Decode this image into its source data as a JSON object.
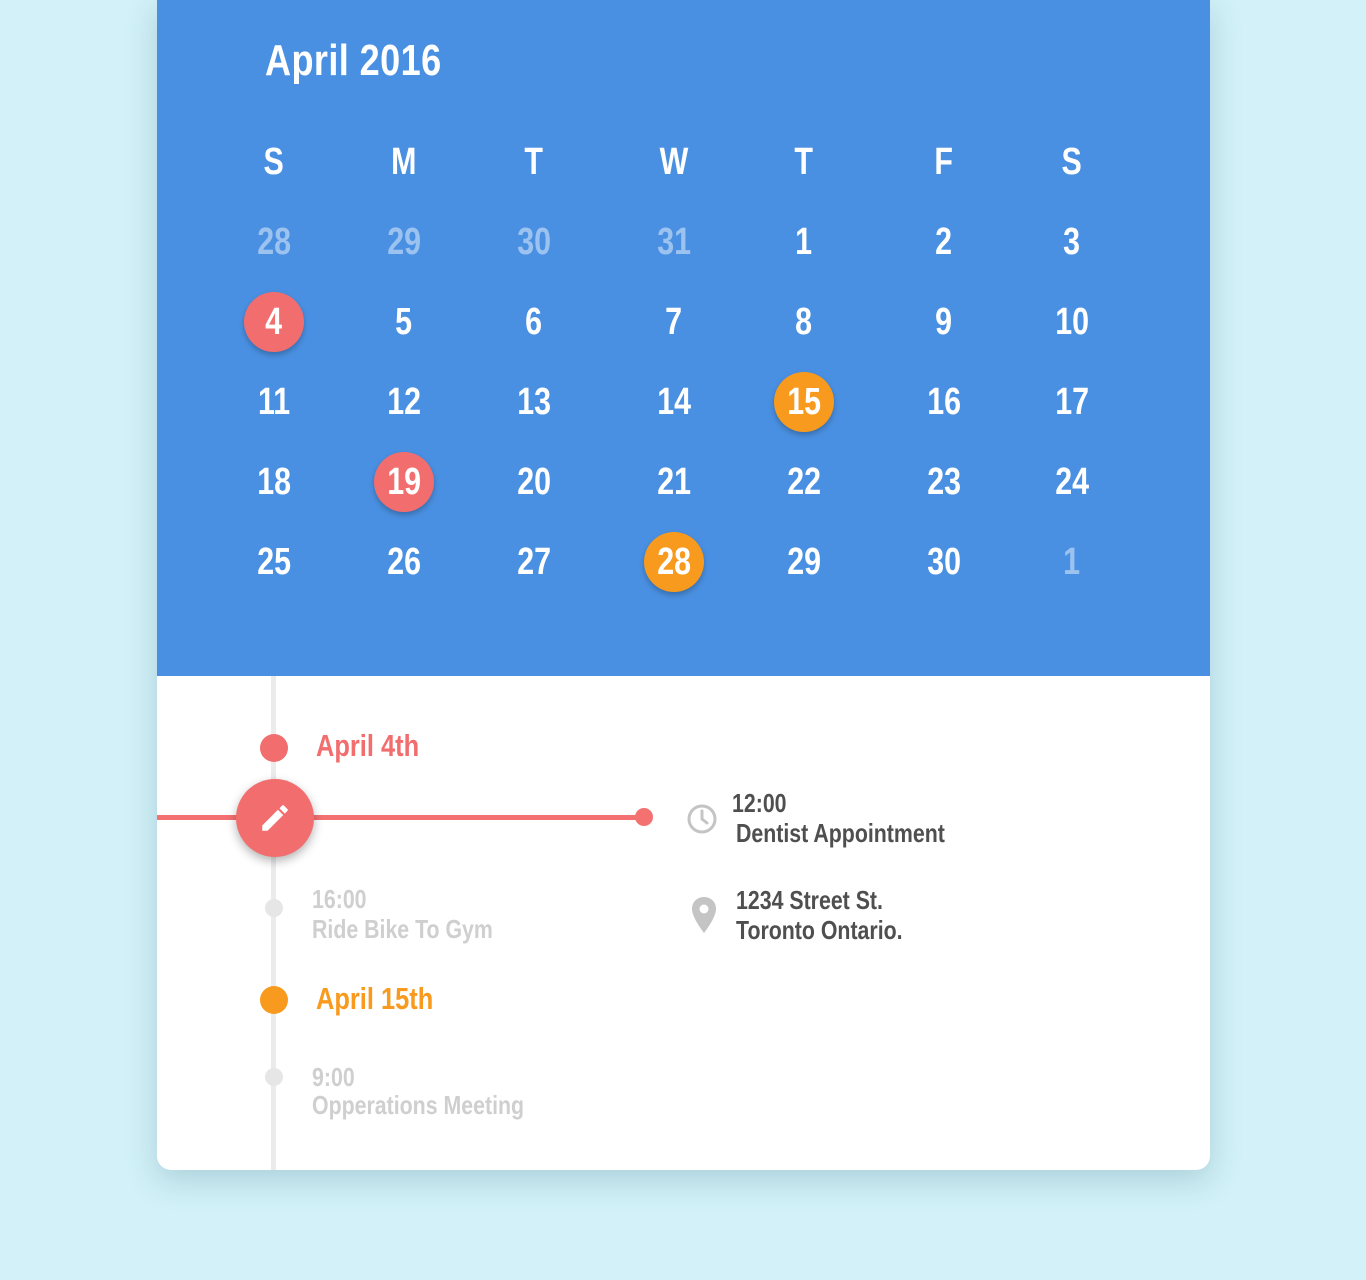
{
  "calendar": {
    "month_title": "April 2016",
    "weekdays": [
      "S",
      "M",
      "T",
      "W",
      "T",
      "F",
      "S"
    ],
    "weeks": [
      [
        {
          "d": "28",
          "dim": true
        },
        {
          "d": "29",
          "dim": true
        },
        {
          "d": "30",
          "dim": true
        },
        {
          "d": "31",
          "dim": true
        },
        {
          "d": "1"
        },
        {
          "d": "2"
        },
        {
          "d": "3"
        }
      ],
      [
        {
          "d": "4",
          "mark": "red"
        },
        {
          "d": "5"
        },
        {
          "d": "6"
        },
        {
          "d": "7"
        },
        {
          "d": "8"
        },
        {
          "d": "9"
        },
        {
          "d": "10"
        }
      ],
      [
        {
          "d": "11"
        },
        {
          "d": "12"
        },
        {
          "d": "13"
        },
        {
          "d": "14"
        },
        {
          "d": "15",
          "mark": "orange"
        },
        {
          "d": "16"
        },
        {
          "d": "17"
        }
      ],
      [
        {
          "d": "18"
        },
        {
          "d": "19",
          "mark": "red"
        },
        {
          "d": "20"
        },
        {
          "d": "21"
        },
        {
          "d": "22"
        },
        {
          "d": "23"
        },
        {
          "d": "24"
        }
      ],
      [
        {
          "d": "25"
        },
        {
          "d": "26"
        },
        {
          "d": "27"
        },
        {
          "d": "28",
          "mark": "orange"
        },
        {
          "d": "29"
        },
        {
          "d": "30"
        },
        {
          "d": "1",
          "dim": true
        }
      ]
    ]
  },
  "colors": {
    "header_bg": "#4a90e2",
    "red": "#f26d6d",
    "orange": "#f79a1e",
    "dim_text": "#9cc2f0",
    "muted_text": "#cfcfcf",
    "dark_text": "#4f4f4f"
  },
  "agenda": {
    "groups": [
      {
        "date": "April 4th",
        "color": "red",
        "events": [
          {
            "time": "16:00",
            "name": "Ride Bike To Gym"
          }
        ]
      },
      {
        "date": "April 15th",
        "color": "orange",
        "events": [
          {
            "time": "9:00",
            "name": "Opperations Meeting"
          }
        ]
      }
    ],
    "active_event": {
      "time": "12:00",
      "name": "Dentist Appointment",
      "address_line1": "1234 Street St.",
      "address_line2": "Toronto Ontario."
    },
    "icons": {
      "edit": "pencil-icon",
      "time": "clock-icon",
      "location": "map-pin-icon"
    }
  }
}
